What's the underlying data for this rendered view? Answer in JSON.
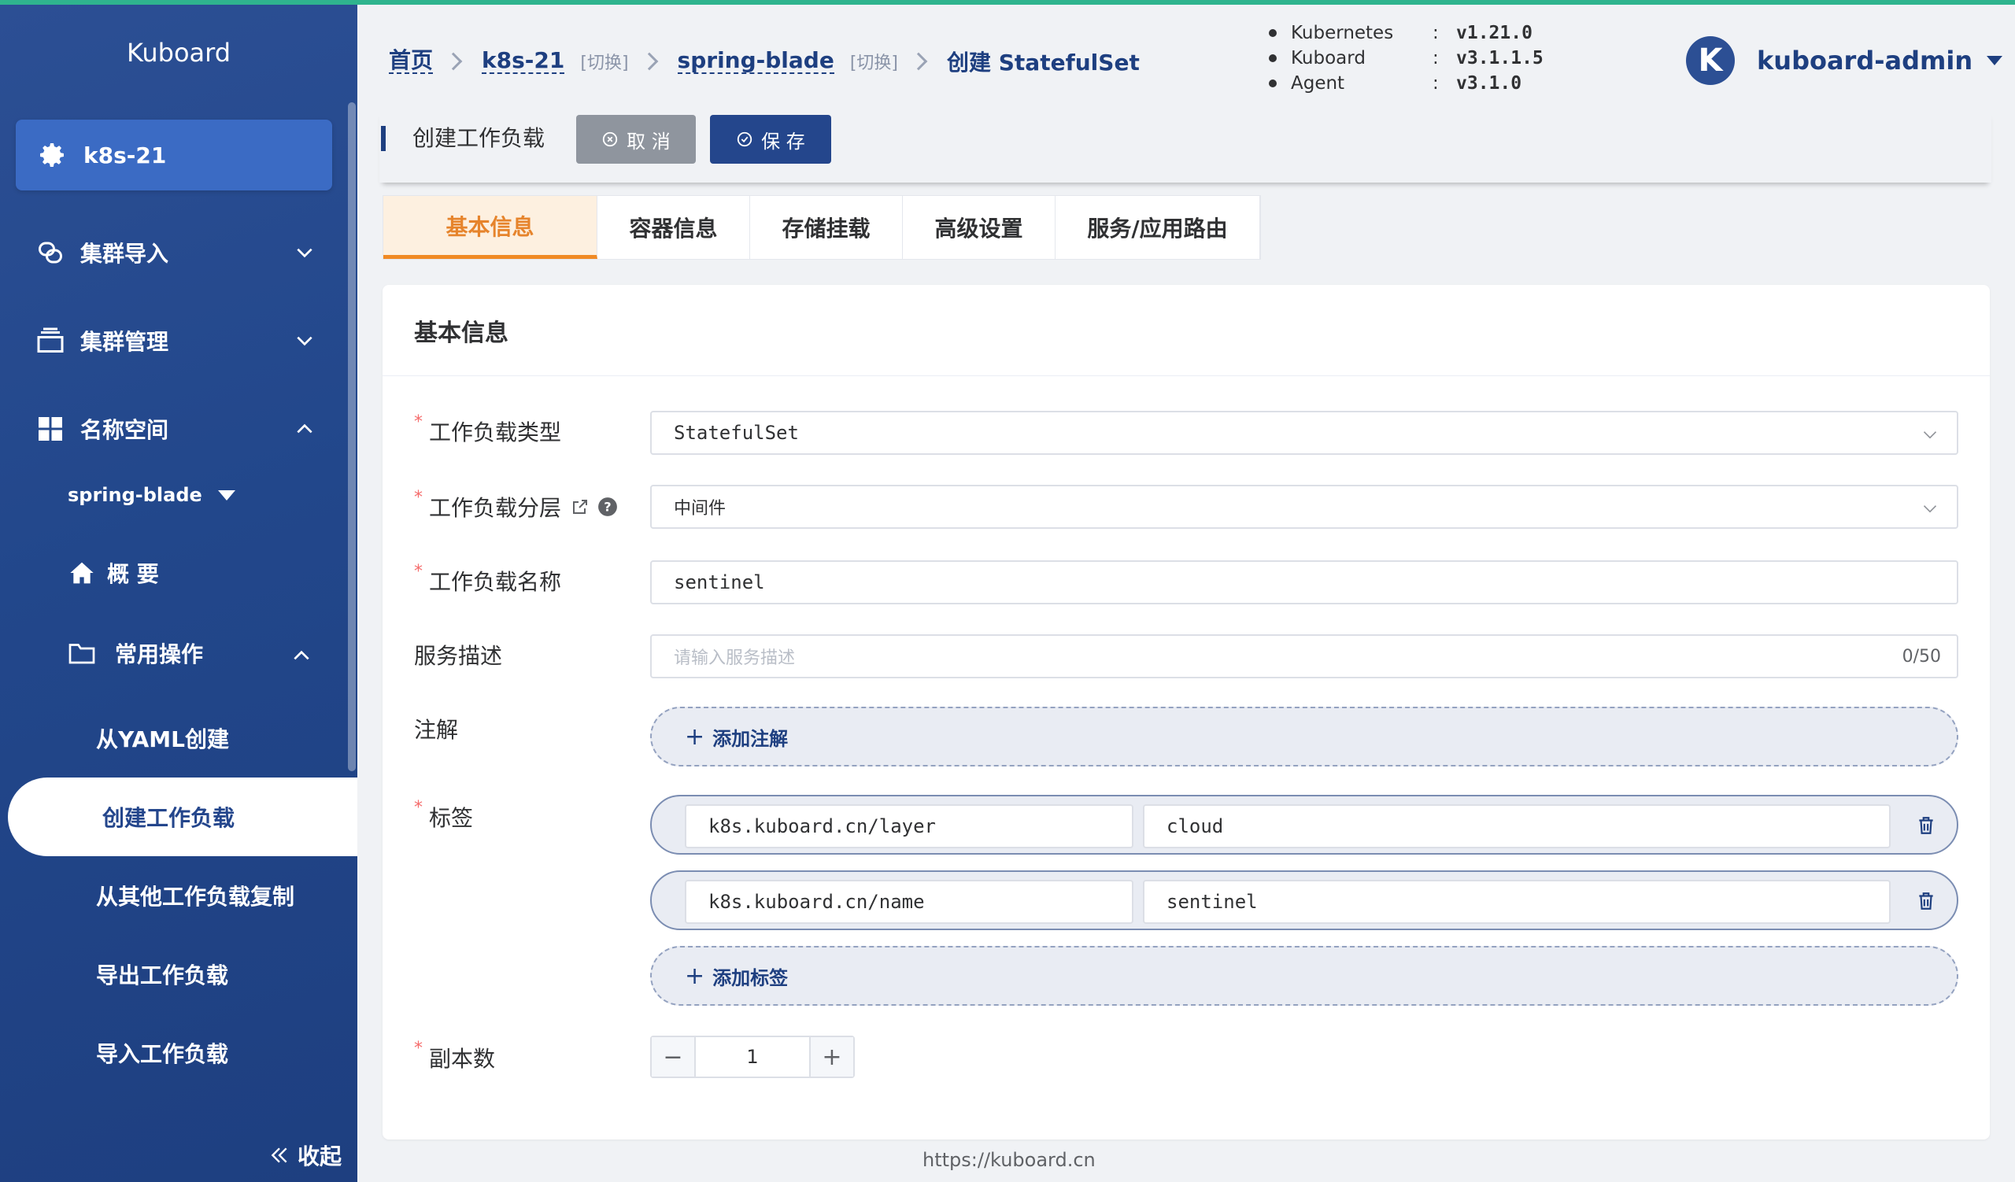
{
  "brand": "Kuboard",
  "sidebar": {
    "cluster": "k8s-21",
    "menu": [
      {
        "label": "集群导入"
      },
      {
        "label": "集群管理"
      },
      {
        "label": "名称空间"
      }
    ],
    "namespace": "spring-blade",
    "overview": "概 要",
    "common_ops": "常用操作",
    "items": [
      {
        "label": "从YAML创建"
      },
      {
        "label": "创建工作负载"
      },
      {
        "label": "从其他工作负载复制"
      },
      {
        "label": "导出工作负载"
      },
      {
        "label": "导入工作负载"
      }
    ],
    "collapse": "收起"
  },
  "breadcrumb": {
    "home": "首页",
    "cluster": "k8s-21",
    "switch": "[切换]",
    "namespace": "spring-blade",
    "current": "创建 StatefulSet"
  },
  "versions": [
    {
      "name": "Kubernetes",
      "value": "v1.21.0"
    },
    {
      "name": "Kuboard",
      "value": "v3.1.1.5"
    },
    {
      "name": "Agent",
      "value": "v3.1.0"
    }
  ],
  "user": {
    "avatar": "K",
    "name": "kuboard-admin"
  },
  "page": {
    "title": "创建工作负载",
    "cancel": "取 消",
    "save": "保 存"
  },
  "tabs": [
    {
      "label": "基本信息",
      "active": true
    },
    {
      "label": "容器信息"
    },
    {
      "label": "存储挂载"
    },
    {
      "label": "高级设置"
    },
    {
      "label": "服务/应用路由"
    }
  ],
  "form": {
    "section_title": "基本信息",
    "required_mark": "*",
    "workload_type": {
      "label": "工作负载类型",
      "value": "StatefulSet"
    },
    "workload_layer": {
      "label": "工作负载分层",
      "value": "中间件"
    },
    "workload_name": {
      "label": "工作负载名称",
      "value": "sentinel"
    },
    "description": {
      "label": "服务描述",
      "placeholder": "请输入服务描述",
      "counter": "0/50"
    },
    "annotations": {
      "label": "注解",
      "add": "添加注解"
    },
    "labels": {
      "label": "标签",
      "rows": [
        {
          "key": "k8s.kuboard.cn/layer",
          "value": "cloud"
        },
        {
          "key": "k8s.kuboard.cn/name",
          "value": "sentinel"
        }
      ],
      "add": "添加标签"
    },
    "replicas": {
      "label": "副本数",
      "value": "1"
    }
  },
  "footer": "https://kuboard.cn",
  "colors": {
    "sidebar": "#22478b",
    "accent": "#f08a24",
    "primary": "#24468c",
    "top_accent": "#2fb48e"
  }
}
